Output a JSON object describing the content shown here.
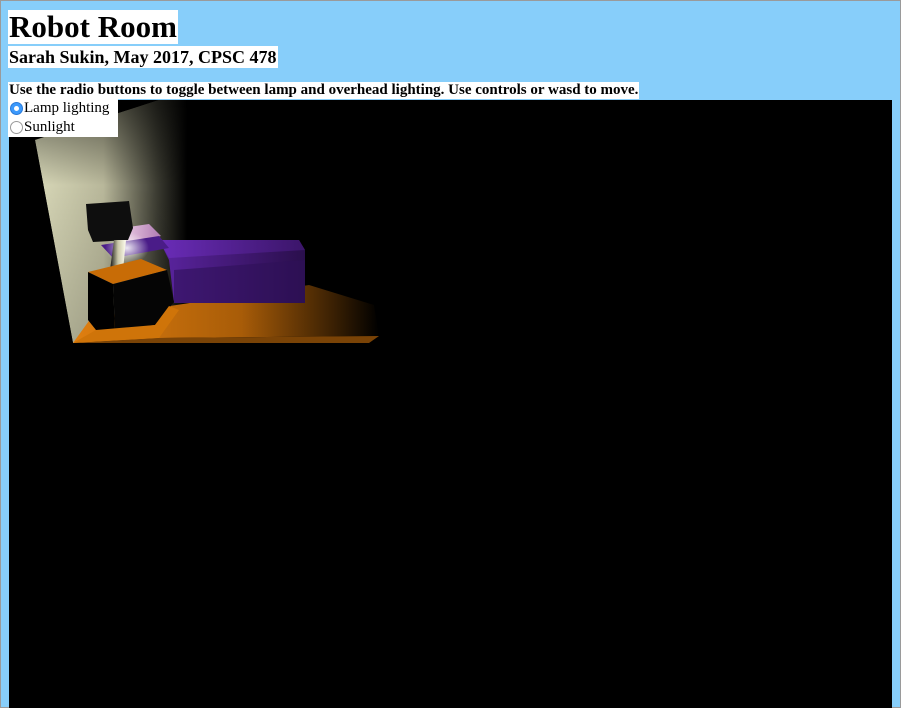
{
  "page": {
    "title": "Robot Room",
    "subtitle": "Sarah Sukin, May 2017, CPSC 478",
    "instructions": "Use the radio buttons to toggle between lamp and overhead lighting. Use controls or wasd to move."
  },
  "lighting": {
    "options": [
      {
        "label": "Lamp lighting",
        "checked": true
      },
      {
        "label": "Sunlight",
        "checked": false
      }
    ]
  },
  "colors": {
    "page_background": "#87cefa",
    "scene_background": "#000000",
    "radio_accent": "#3b99fc",
    "bed_cover": "#4a1a86",
    "floor": "#d97a0c",
    "wall": "#b6b597"
  }
}
